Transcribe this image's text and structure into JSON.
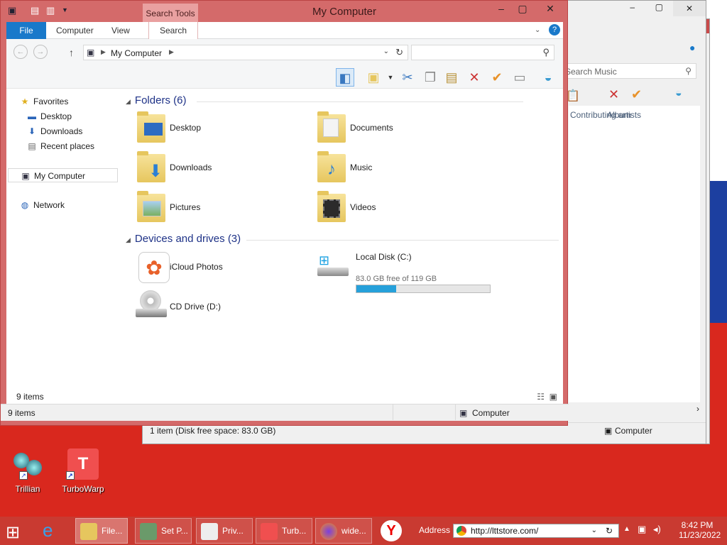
{
  "window": {
    "title": "My Computer",
    "contextual_tab": "Search Tools"
  },
  "ribbon": {
    "tabs": [
      {
        "label": "File"
      },
      {
        "label": "Computer"
      },
      {
        "label": "View"
      },
      {
        "label": "Search"
      }
    ]
  },
  "address": {
    "path": "My Computer",
    "search_placeholder": ""
  },
  "nav": {
    "favorites": "Favorites",
    "desktop": "Desktop",
    "downloads": "Downloads",
    "recent": "Recent places",
    "my_computer": "My Computer",
    "network": "Network"
  },
  "folders": {
    "header": "Folders (6)",
    "items": [
      "Desktop",
      "Documents",
      "Downloads",
      "Music",
      "Pictures",
      "Videos"
    ]
  },
  "devices": {
    "header": "Devices and drives (3)",
    "icloud": "iCloud Photos",
    "local_disk": "Local Disk (C:)",
    "local_disk_free": "83.0 GB free of 119 GB",
    "local_disk_used_fraction": 0.3,
    "cd_drive": "CD Drive (D:)"
  },
  "status": {
    "inner_count": "9 items",
    "outer_count": "9 items",
    "outer_location": "Computer"
  },
  "back_window": {
    "search_placeholder": "Search Music",
    "col_artists": "Contributing artists",
    "col_album": "Album",
    "status_text": "1 item (Disk free space: 83.0 GB)",
    "status_location": "Computer"
  },
  "desktop_icons": [
    {
      "label": "Trillian"
    },
    {
      "label": "TurboWarp"
    }
  ],
  "taskbar": {
    "buttons": [
      {
        "label": "File..."
      },
      {
        "label": "Set P..."
      },
      {
        "label": "Priv..."
      },
      {
        "label": "Turb..."
      },
      {
        "label": "wide..."
      }
    ],
    "address_label": "Address",
    "address_value": "http://lttstore.com/",
    "time": "8:42 PM",
    "date": "11/23/2022"
  },
  "colors": {
    "accent": "#1979ca",
    "frame": "#d46a6a",
    "desktop": "#d9281e",
    "progress": "#26a0da"
  }
}
